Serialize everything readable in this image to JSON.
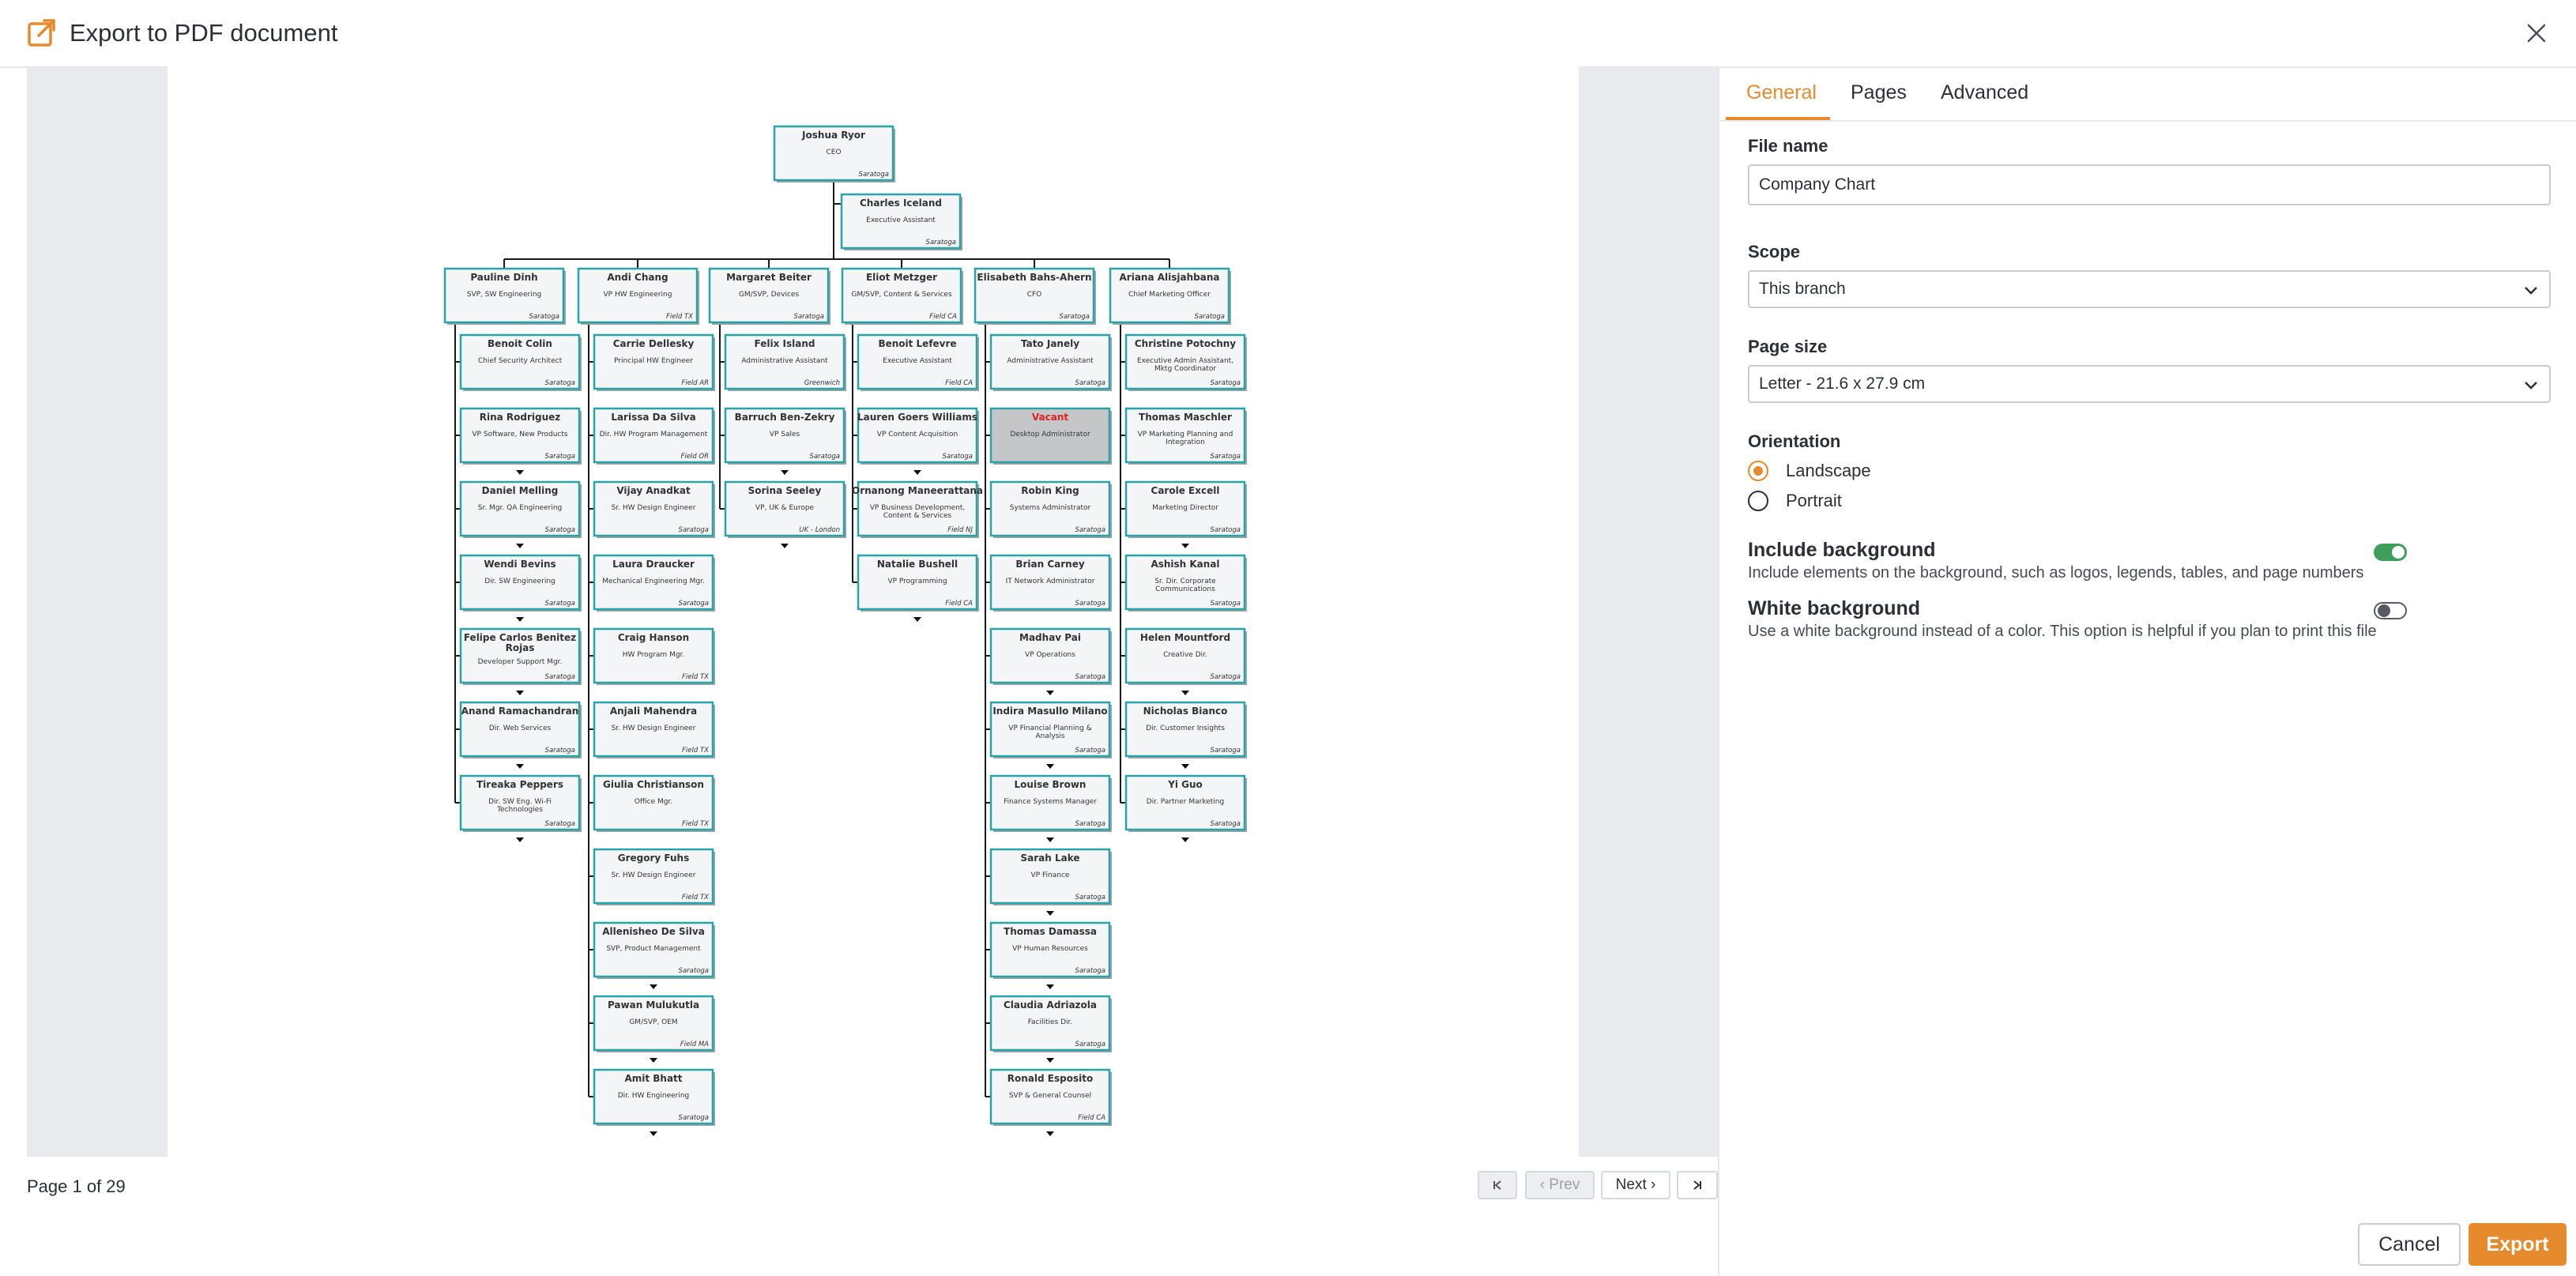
{
  "dialog": {
    "title": "Export to PDF document",
    "icon": "export-icon",
    "close_icon": "close-icon"
  },
  "colors": {
    "accent": "#e58a2d",
    "node_border": "#2aa3a8",
    "vacant_text": "#e02020",
    "toggle_on": "#3f9e5a"
  },
  "preview": {
    "page_info": "Page 1 of 29",
    "pager": {
      "first_icon": "first-page-icon",
      "prev": "Prev",
      "next": "Next",
      "last_icon": "last-page-icon"
    }
  },
  "tabs": [
    {
      "label": "General"
    },
    {
      "label": "Pages"
    },
    {
      "label": "Advanced"
    }
  ],
  "general": {
    "file_name": {
      "label": "File name",
      "value": "Company Chart"
    },
    "scope": {
      "label": "Scope",
      "value": "This branch"
    },
    "page_size": {
      "label": "Page size",
      "value": "Letter - 21.6 x 27.9 cm"
    },
    "orientation": {
      "label": "Orientation",
      "options": [
        {
          "label": "Landscape",
          "checked": true
        },
        {
          "label": "Portrait",
          "checked": false
        }
      ]
    },
    "include_background": {
      "title": "Include background",
      "description": "Include elements on the background, such as logos, legends, tables, and page numbers",
      "on": true
    },
    "white_background": {
      "title": "White background",
      "description": "Use a white background instead of a color. This option is helpful if you plan to print this file",
      "on": false
    }
  },
  "buttons": {
    "cancel": "Cancel",
    "export": "Export"
  },
  "org_chart": {
    "ceo": {
      "name": "Joshua Ryor",
      "title": "CEO",
      "location": "Saratoga"
    },
    "assistant": {
      "name": "Charles Iceland",
      "title": "Executive Assistant",
      "location": "Saratoga"
    },
    "columns": [
      {
        "head": {
          "name": "Pauline Dinh",
          "title": "SVP, SW Engineering",
          "location": "Saratoga"
        },
        "reports": [
          {
            "name": "Benoit Colin",
            "title": "Chief Security Architect",
            "location": "Saratoga"
          },
          {
            "name": "Rina Rodriguez",
            "title": "VP Software, New Products",
            "location": "Saratoga",
            "more": true
          },
          {
            "name": "Daniel Melling",
            "title": "Sr. Mgr. QA Engineering",
            "location": "Saratoga",
            "more": true
          },
          {
            "name": "Wendi Bevins",
            "title": "Dir. SW Engineering",
            "location": "Saratoga",
            "more": true
          },
          {
            "name": "Felipe Carlos Benitez Rojas",
            "title": "Developer Support Mgr.",
            "location": "Saratoga",
            "more": true
          },
          {
            "name": "Anand Ramachandran",
            "title": "Dir. Web Services",
            "location": "Saratoga",
            "more": true
          },
          {
            "name": "Tireaka Peppers",
            "title": "Dir. SW Eng. Wi-Fi Technologies",
            "location": "Saratoga",
            "more": true
          }
        ]
      },
      {
        "head": {
          "name": "Andi Chang",
          "title": "VP HW Engineering",
          "location": "Field TX"
        },
        "reports": [
          {
            "name": "Carrie Dellesky",
            "title": "Principal HW Engineer",
            "location": "Field AR"
          },
          {
            "name": "Larissa Da Silva",
            "title": "Dir. HW Program Management",
            "location": "Field OR"
          },
          {
            "name": "Vijay Anadkat",
            "title": "Sr. HW Design Engineer",
            "location": "Saratoga"
          },
          {
            "name": "Laura Draucker",
            "title": "Mechanical Engineering Mgr.",
            "location": "Saratoga"
          },
          {
            "name": "Craig Hanson",
            "title": "HW Program Mgr.",
            "location": "Field TX"
          },
          {
            "name": "Anjali Mahendra",
            "title": "Sr. HW Design Engineer",
            "location": "Field TX"
          },
          {
            "name": "Giulia Christianson",
            "title": "Office Mgr.",
            "location": "Field TX"
          },
          {
            "name": "Gregory Fuhs",
            "title": "Sr. HW Design Engineer",
            "location": "Field TX"
          },
          {
            "name": "Allenisheo De Silva",
            "title": "SVP, Product Management",
            "location": "Saratoga",
            "more": true
          },
          {
            "name": "Pawan Mulukutla",
            "title": "GM/SVP, OEM",
            "location": "Field MA",
            "more": true
          },
          {
            "name": "Amit Bhatt",
            "title": "Dir. HW Engineering",
            "location": "Saratoga",
            "more": true
          }
        ]
      },
      {
        "head": {
          "name": "Margaret Beiter",
          "title": "GM/SVP, Devices",
          "location": "Saratoga"
        },
        "reports": [
          {
            "name": "Felix Island",
            "title": "Administrative Assistant",
            "location": "Greenwich"
          },
          {
            "name": "Barruch Ben-Zekry",
            "title": "VP Sales",
            "location": "Saratoga",
            "more": true
          },
          {
            "name": "Sorina Seeley",
            "title": "VP, UK & Europe",
            "location": "UK - London",
            "more": true
          }
        ]
      },
      {
        "head": {
          "name": "Eliot Metzger",
          "title": "GM/SVP, Content & Services",
          "location": "Field CA"
        },
        "reports": [
          {
            "name": "Benoit Lefevre",
            "title": "Executive Assistant",
            "location": "Field CA"
          },
          {
            "name": "Lauren Goers Williams",
            "title": "VP Content Acquisition",
            "location": "Saratoga",
            "more": true
          },
          {
            "name": "Ornanong Maneerattana",
            "title": "VP Business Development, Content & Services",
            "location": "Field NJ"
          },
          {
            "name": "Natalie Bushell",
            "title": "VP Programming",
            "location": "Field CA",
            "more": true
          }
        ]
      },
      {
        "head": {
          "name": "Elisabeth Bahs-Ahern",
          "title": "CFO",
          "location": "Saratoga"
        },
        "reports": [
          {
            "name": "Tato Janely",
            "title": "Administrative Assistant",
            "location": "Saratoga"
          },
          {
            "name": "Vacant",
            "title": "Desktop Administrator",
            "location": "",
            "vacant": true
          },
          {
            "name": "Robin King",
            "title": "Systems Administrator",
            "location": "Saratoga"
          },
          {
            "name": "Brian Carney",
            "title": "IT Network Administrator",
            "location": "Saratoga"
          },
          {
            "name": "Madhav Pai",
            "title": "VP Operations",
            "location": "Saratoga",
            "more": true
          },
          {
            "name": "Indira Masullo Milano",
            "title": "VP Financial Planning & Analysis",
            "location": "Saratoga",
            "more": true
          },
          {
            "name": "Louise Brown",
            "title": "Finance Systems Manager",
            "location": "Saratoga",
            "more": true
          },
          {
            "name": "Sarah Lake",
            "title": "VP Finance",
            "location": "Saratoga",
            "more": true
          },
          {
            "name": "Thomas Damassa",
            "title": "VP Human Resources",
            "location": "Saratoga",
            "more": true
          },
          {
            "name": "Claudia Adriazola",
            "title": "Facilities Dir.",
            "location": "Saratoga",
            "more": true
          },
          {
            "name": "Ronald Esposito",
            "title": "SVP & General Counsel",
            "location": "Field CA",
            "more": true
          }
        ]
      },
      {
        "head": {
          "name": "Ariana Alisjahbana",
          "title": "Chief Marketing Officer",
          "location": "Saratoga"
        },
        "reports": [
          {
            "name": "Christine Potochny",
            "title": "Executive Admin Assistant, Mktg Coordinator",
            "location": "Saratoga"
          },
          {
            "name": "Thomas Maschler",
            "title": "VP Marketing Planning and Integration",
            "location": "Saratoga"
          },
          {
            "name": "Carole Excell",
            "title": "Marketing Director",
            "location": "Saratoga",
            "more": true
          },
          {
            "name": "Ashish Kanal",
            "title": "Sr. Dir. Corporate Communications",
            "location": "Saratoga"
          },
          {
            "name": "Helen Mountford",
            "title": "Creative Dir.",
            "location": "Saratoga",
            "more": true
          },
          {
            "name": "Nicholas Bianco",
            "title": "Dir. Customer Insights",
            "location": "Saratoga",
            "more": true
          },
          {
            "name": "Yi Guo",
            "title": "Dir. Partner Marketing",
            "location": "Saratoga",
            "more": true
          }
        ]
      }
    ]
  }
}
